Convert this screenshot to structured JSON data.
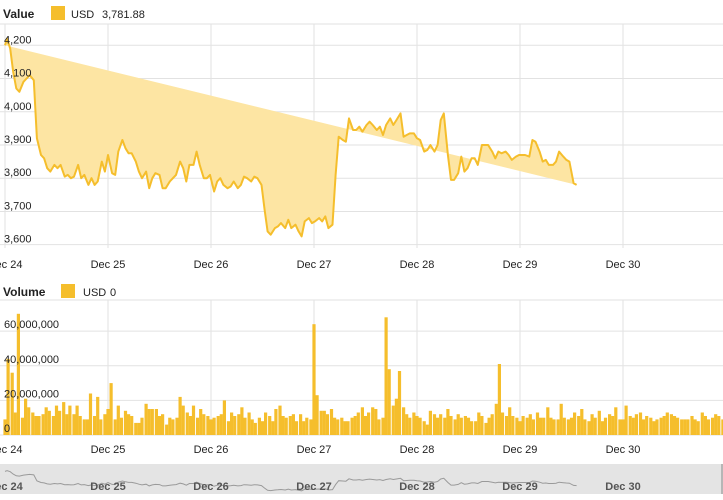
{
  "colors": {
    "series": "#f5be2c",
    "area": "#fde5a3",
    "grid": "#e2e2e2",
    "text": "#222222",
    "navigator_bg": "#e4e4e4",
    "navigator_line": "#9a9a9a"
  },
  "chart_data": [
    {
      "type": "area",
      "title": "Value",
      "legend": [
        {
          "name": "USD",
          "value_text": "3,781.88"
        }
      ],
      "x_ticks": [
        "Dec 24",
        "Dec 25",
        "Dec 26",
        "Dec 27",
        "Dec 28",
        "Dec 29",
        "Dec 30"
      ],
      "y_ticks": [
        "4,200",
        "4,100",
        "4,000",
        "3,900",
        "3,800",
        "3,700",
        "3,600"
      ],
      "x_range_days": [
        0,
        7.2
      ],
      "ylim": [
        3580,
        4280
      ],
      "grid": true,
      "series": [
        {
          "name": "USD",
          "x_days": [
            0.0,
            0.02,
            0.05,
            0.08,
            0.11,
            0.14,
            0.18,
            0.21,
            0.24,
            0.28,
            0.31,
            0.35,
            0.38,
            0.41,
            0.44,
            0.48,
            0.51,
            0.54,
            0.58,
            0.61,
            0.64,
            0.67,
            0.71,
            0.74,
            0.77,
            0.81,
            0.84,
            0.87,
            0.9,
            0.94,
            0.97,
            1.0,
            1.04,
            1.07,
            1.1,
            1.14,
            1.17,
            1.2,
            1.23,
            1.27,
            1.3,
            1.33,
            1.37,
            1.4,
            1.43,
            1.46,
            1.5,
            1.53,
            1.56,
            1.6,
            1.63,
            1.66,
            1.7,
            1.73,
            1.76,
            1.79,
            1.83,
            1.86,
            1.89,
            1.93,
            1.96,
            1.99,
            2.03,
            2.06,
            2.09,
            2.12,
            2.16,
            2.19,
            2.22,
            2.26,
            2.29,
            2.32,
            2.35,
            2.39,
            2.42,
            2.45,
            2.49,
            2.52,
            2.55,
            2.58,
            2.62,
            2.65,
            2.68,
            2.72,
            2.75,
            2.78,
            2.82,
            2.85,
            2.88,
            2.91,
            2.95,
            2.98,
            3.01,
            3.05,
            3.08,
            3.11,
            3.14,
            3.18,
            3.21,
            3.24,
            3.28,
            3.31,
            3.34,
            3.38,
            3.41,
            3.44,
            3.47,
            3.51,
            3.54,
            3.57,
            3.61,
            3.64,
            3.67,
            3.7,
            3.74,
            3.77,
            3.8,
            3.84,
            3.87,
            3.9,
            3.93,
            3.97,
            4.0,
            4.03,
            4.07,
            4.1,
            4.13,
            4.17,
            4.2,
            4.23,
            4.26,
            4.3,
            4.33,
            4.36,
            4.4,
            4.43,
            4.46,
            4.49,
            4.53,
            4.56,
            4.59,
            4.63,
            4.66,
            4.69,
            4.73,
            4.76,
            4.79,
            4.82,
            4.86,
            4.89,
            4.92,
            4.96,
            4.99,
            5.02,
            5.05,
            5.09,
            5.12,
            5.15,
            5.19,
            5.22,
            5.25,
            5.28,
            5.32,
            5.35,
            5.38,
            5.42,
            5.45,
            5.48,
            5.52,
            5.55,
            5.58,
            5.61,
            5.65,
            5.68,
            5.71,
            5.75,
            5.78,
            5.81,
            5.84,
            5.88,
            5.91,
            5.94,
            5.98,
            6.01,
            6.04,
            6.08,
            6.11,
            6.14,
            6.17,
            6.21,
            6.24,
            6.27,
            6.31,
            6.34,
            6.37,
            6.4,
            6.44,
            6.47,
            6.5,
            6.54,
            6.57,
            6.6,
            6.63,
            6.67,
            6.7,
            6.73,
            6.77,
            6.8,
            6.83,
            6.87,
            6.9,
            6.93,
            6.96,
            7.0,
            7.03,
            7.06,
            7.1,
            7.13
          ],
          "values": [
            4200,
            4220,
            4190,
            4120,
            4070,
            4060,
            4090,
            4100,
            4110,
            4095,
            3920,
            3870,
            3860,
            3830,
            3820,
            3840,
            3830,
            3840,
            3805,
            3810,
            3800,
            3805,
            3840,
            3800,
            3810,
            3780,
            3800,
            3780,
            3790,
            3850,
            3820,
            3870,
            3815,
            3810,
            3880,
            3915,
            3890,
            3875,
            3875,
            3850,
            3820,
            3800,
            3820,
            3770,
            3800,
            3815,
            3810,
            3770,
            3770,
            3790,
            3800,
            3810,
            3850,
            3830,
            3790,
            3840,
            3840,
            3880,
            3840,
            3800,
            3800,
            3810,
            3760,
            3790,
            3800,
            3780,
            3770,
            3775,
            3790,
            3770,
            3780,
            3805,
            3800,
            3790,
            3805,
            3800,
            3780,
            3705,
            3640,
            3630,
            3650,
            3655,
            3665,
            3650,
            3675,
            3650,
            3660,
            3640,
            3625,
            3670,
            3680,
            3665,
            3670,
            3680,
            3670,
            3685,
            3650,
            3660,
            3810,
            3925,
            3915,
            3910,
            3980,
            3945,
            3945,
            3955,
            3940,
            3960,
            3970,
            3960,
            3945,
            3955,
            3930,
            3960,
            3980,
            3960,
            3975,
            3995,
            3925,
            3930,
            3935,
            3935,
            3920,
            3915,
            3880,
            3885,
            3900,
            3880,
            3900,
            3975,
            3995,
            3870,
            3795,
            3795,
            3815,
            3865,
            3820,
            3830,
            3860,
            3860,
            3840,
            3900,
            3900,
            3900,
            3880,
            3860,
            3880,
            3875,
            3880,
            3870,
            3855,
            3865,
            3870,
            3870,
            3870,
            3865,
            3915,
            3910,
            3880,
            3850,
            3855,
            3840,
            3840,
            3850,
            3880,
            3865,
            3855,
            3850,
            3785,
            3780
          ]
        }
      ]
    },
    {
      "type": "bar",
      "title": "Volume",
      "legend": [
        {
          "name": "USD",
          "value_text": "0"
        }
      ],
      "x_ticks": [
        "Dec 24",
        "Dec 25",
        "Dec 26",
        "Dec 27",
        "Dec 28",
        "Dec 29",
        "Dec 30"
      ],
      "y_ticks": [
        "60,000,000",
        "40,000,000",
        "20,000,000",
        "0"
      ],
      "x_range_days": [
        0,
        7.2
      ],
      "ylim": [
        0,
        78000000
      ],
      "grid": true,
      "series": [
        {
          "name": "USD",
          "x_days": [
            0.0,
            0.03,
            0.07,
            0.1,
            0.13,
            0.17,
            0.2,
            0.23,
            0.27,
            0.3,
            0.33,
            0.37,
            0.4,
            0.43,
            0.47,
            0.5,
            0.53,
            0.57,
            0.6,
            0.63,
            0.67,
            0.7,
            0.73,
            0.77,
            0.8,
            0.83,
            0.87,
            0.9,
            0.93,
            0.97,
            1.0,
            1.03,
            1.07,
            1.1,
            1.13,
            1.17,
            1.2,
            1.23,
            1.27,
            1.3,
            1.33,
            1.37,
            1.4,
            1.43,
            1.47,
            1.5,
            1.53,
            1.57,
            1.6,
            1.63,
            1.67,
            1.7,
            1.73,
            1.77,
            1.8,
            1.83,
            1.87,
            1.9,
            1.93,
            1.97,
            2.0,
            2.03,
            2.07,
            2.1,
            2.13,
            2.17,
            2.2,
            2.23,
            2.27,
            2.3,
            2.33,
            2.37,
            2.4,
            2.43,
            2.47,
            2.5,
            2.53,
            2.57,
            2.6,
            2.63,
            2.67,
            2.7,
            2.73,
            2.77,
            2.8,
            2.83,
            2.87,
            2.9,
            2.93,
            2.97,
            3.0,
            3.03,
            3.07,
            3.1,
            3.13,
            3.17,
            3.2,
            3.23,
            3.27,
            3.3,
            3.33,
            3.37,
            3.4,
            3.43,
            3.47,
            3.5,
            3.53,
            3.57,
            3.6,
            3.63,
            3.67,
            3.7,
            3.73,
            3.77,
            3.8,
            3.83,
            3.87,
            3.9,
            3.93,
            3.97,
            4.0,
            4.03,
            4.07,
            4.1,
            4.13,
            4.17,
            4.2,
            4.23,
            4.27,
            4.3,
            4.33,
            4.37,
            4.4,
            4.43,
            4.47,
            4.5,
            4.53,
            4.57,
            4.6,
            4.63,
            4.67,
            4.7,
            4.73,
            4.77,
            4.8,
            4.83,
            4.87,
            4.9,
            4.93,
            4.97,
            5.0,
            5.03,
            5.07,
            5.1,
            5.13,
            5.17,
            5.2,
            5.23,
            5.27,
            5.3,
            5.33,
            5.37,
            5.4,
            5.43,
            5.47,
            5.5,
            5.53,
            5.57,
            5.6,
            5.63,
            5.67,
            5.7,
            5.73,
            5.77,
            5.8,
            5.83,
            5.87,
            5.9,
            5.93,
            5.97,
            6.0,
            6.03,
            6.07,
            6.1,
            6.13,
            6.17,
            6.2,
            6.23,
            6.27,
            6.3,
            6.33,
            6.37,
            6.4,
            6.43,
            6.47,
            6.5,
            6.53,
            6.57,
            6.6,
            6.63,
            6.67,
            6.7,
            6.73,
            6.77,
            6.8,
            6.83,
            6.87,
            6.9,
            6.93,
            6.97,
            7.0,
            7.03,
            7.07,
            7.1,
            7.13
          ],
          "values": [
            9000000,
            44000000,
            36000000,
            13000000,
            70000000,
            10000000,
            21000000,
            16000000,
            13000000,
            11000000,
            11000000,
            12000000,
            16000000,
            14000000,
            11000000,
            17000000,
            14000000,
            19000000,
            12000000,
            17000000,
            12000000,
            17000000,
            11000000,
            9000000,
            9000000,
            24000000,
            11000000,
            22000000,
            9000000,
            12000000,
            15000000,
            30000000,
            9000000,
            17000000,
            10000000,
            14000000,
            12000000,
            11000000,
            7000000,
            7000000,
            10000000,
            18000000,
            15000000,
            15000000,
            15000000,
            11000000,
            12000000,
            6000000,
            10000000,
            9000000,
            10000000,
            22000000,
            17000000,
            13000000,
            11000000,
            17000000,
            10000000,
            15000000,
            12000000,
            11000000,
            9000000,
            10000000,
            11000000,
            12000000,
            20000000,
            8000000,
            13000000,
            11000000,
            12000000,
            16000000,
            10000000,
            13000000,
            9000000,
            7000000,
            10000000,
            8000000,
            13000000,
            11000000,
            8000000,
            15000000,
            17000000,
            11000000,
            10000000,
            11000000,
            12000000,
            8000000,
            12000000,
            8000000,
            10000000,
            9000000,
            64000000,
            23000000,
            14000000,
            14000000,
            12000000,
            15000000,
            10000000,
            9000000,
            10000000,
            8000000,
            8000000,
            10000000,
            11000000,
            13000000,
            16000000,
            11000000,
            13000000,
            16000000,
            15000000,
            9000000,
            10000000,
            68000000,
            38000000,
            17000000,
            21000000,
            37000000,
            16000000,
            12000000,
            10000000,
            13000000,
            11000000,
            10000000,
            8000000,
            6000000,
            14000000,
            12000000,
            10000000,
            12000000,
            10000000,
            15000000,
            11000000,
            9000000,
            12000000,
            10000000,
            11000000,
            10000000,
            8000000,
            8000000,
            13000000,
            11000000,
            7000000,
            10000000,
            12000000,
            18000000,
            41000000,
            13000000,
            11000000,
            16000000,
            11000000,
            10000000,
            8000000,
            11000000,
            10000000,
            12000000,
            9000000,
            13000000,
            10000000,
            10000000,
            16000000,
            10000000,
            9000000,
            9000000,
            18000000,
            10000000,
            9000000,
            10000000,
            13000000,
            11000000,
            15000000,
            9000000,
            8000000,
            12000000,
            10000000,
            14000000,
            8000000,
            10000000,
            12000000,
            11000000,
            16000000,
            9000000,
            9000000,
            17000000,
            11000000,
            10000000,
            12000000,
            13000000,
            9000000,
            11000000,
            10000000,
            8000000,
            9000000,
            10000000,
            11000000,
            13000000,
            12000000,
            11000000,
            10000000,
            9000000,
            9000000,
            9000000,
            11000000,
            9000000,
            8000000,
            13000000,
            11000000,
            9000000,
            10000000,
            12000000,
            11000000,
            9000000,
            10000000,
            11000000,
            9000000,
            8000000,
            10000000,
            9000000,
            11000000,
            9000000,
            18000000,
            6000000
          ]
        }
      ]
    }
  ],
  "navigator": {
    "x_ticks": [
      "Dec 24",
      "Dec 25",
      "Dec 26",
      "Dec 27",
      "Dec 28",
      "Dec 29",
      "Dec 30"
    ]
  }
}
